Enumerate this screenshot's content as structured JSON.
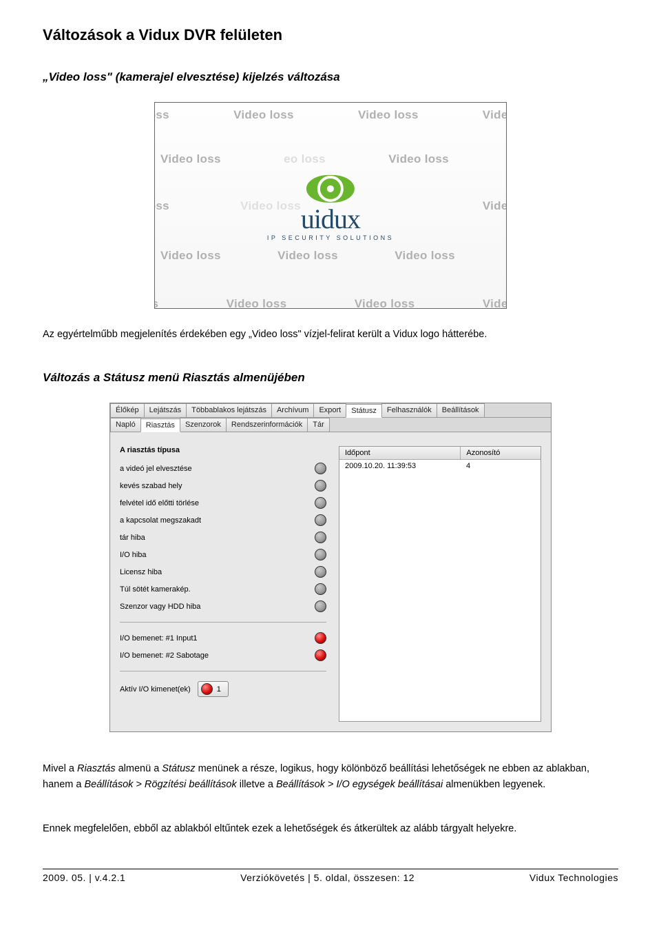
{
  "doc": {
    "title": "Változások a Vidux DVR felületen",
    "section1_title": "„Video loss\" (kamerajel elvesztése) kijelzés változása",
    "para1": "Az egyértelműbb megjelenítés érdekében egy „Video loss\" vízjel-felirat került a Vidux logo hátterébe.",
    "section2_title": "Változás a Státusz menü Riasztás almenüjében",
    "para2_before": "Mivel a ",
    "para2_i1": "Riasztás",
    "para2_mid1": " almenü a ",
    "para2_i2": "Státusz",
    "para2_mid2": " menünek a része, logikus, hogy kölönböző beállítási lehetőségek ne ebben az ablakban, hanem a ",
    "para2_i3": "Beállítások > Rögzítési beállítások",
    "para2_mid3": " illetve a ",
    "para2_i4": "Beállítások > I/O egységek beállításai",
    "para2_mid4": " almenükben legyenek.",
    "para3": "Ennek megfelelően, ebből az ablakból eltűntek ezek a lehetőségek és átkerültek az alább tárgyalt helyekre."
  },
  "shot1": {
    "repeat_text": "Video loss",
    "partial_left": "o loss",
    "partial_right": "Video lo:",
    "partial_bottom_l": "loss",
    "logo_text": "uidux",
    "logo_sub": "IP SECURITY SOLUTIONS"
  },
  "shot2": {
    "tabs1": [
      "Élőkép",
      "Lejátszás",
      "Többablakos lejátszás",
      "Archívum",
      "Export",
      "Státusz",
      "Felhasználók",
      "Beállítások"
    ],
    "tabs1_active": 5,
    "tabs2": [
      "Napló",
      "Riasztás",
      "Szenzorok",
      "Rendszerinformációk",
      "Tár"
    ],
    "tabs2_active": 1,
    "alarm_header": "A riasztás típusa",
    "alarm_types": [
      "a videó jel elvesztése",
      "kevés szabad hely",
      "felvétel idő előtti törlése",
      "a kapcsolat megszakadt",
      "tár hiba",
      "I/O hiba",
      "Licensz hiba",
      "Túl sötét kamerakép.",
      "Szenzor vagy HDD hiba"
    ],
    "io_inputs": [
      {
        "label": "I/O bemenet: #1 Input1",
        "red": true
      },
      {
        "label": "I/O bemenet: #2 Sabotage",
        "red": true
      }
    ],
    "output_label": "Aktív I/O kimenet(ek)",
    "output_value": "1",
    "table_head": [
      "Időpont",
      "Azonosító"
    ],
    "table_row": [
      "2009.10.20. 11:39:53",
      "4"
    ]
  },
  "footer": {
    "left": "2009. 05. | v.4.2.1",
    "center": "Verziókövetés | 5. oldal, összesen: 12",
    "right": "Vidux Technologies"
  }
}
